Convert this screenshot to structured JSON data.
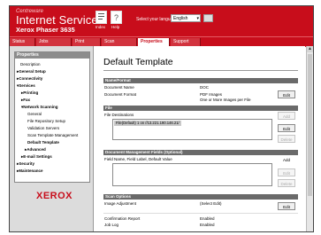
{
  "header": {
    "brand_top": "Centreware",
    "brand_main": "Internet Services",
    "model": "Xerox Phaser 3635",
    "icons": [
      {
        "name": "index-icon",
        "label": "Index"
      },
      {
        "name": "help-icon",
        "label": "Help"
      }
    ],
    "language_label": "Select your language :",
    "language_value": "English"
  },
  "tabs": [
    {
      "label": "Status",
      "active": false
    },
    {
      "label": "Jobs",
      "active": false
    },
    {
      "label": "Print",
      "active": false
    },
    {
      "label": "Scan",
      "active": false
    },
    {
      "label": "Properties",
      "active": true
    },
    {
      "label": "Support",
      "active": false
    }
  ],
  "sidebar": {
    "title": "Properties",
    "items": [
      {
        "label": "Description",
        "bold": false
      },
      {
        "label": "▸General Setup",
        "bold": true
      },
      {
        "label": "▸Connectivity",
        "bold": true
      },
      {
        "label": "▾Services",
        "bold": true
      },
      {
        "label": "▸Printing",
        "bold": true
      },
      {
        "label": "▸Fax",
        "bold": true
      },
      {
        "label": "▾Network Scanning",
        "bold": true
      },
      {
        "label": "General",
        "bold": false
      },
      {
        "label": "File Repository Setup",
        "bold": false
      },
      {
        "label": "Validation Servers",
        "bold": false
      },
      {
        "label": "Scan Template Management",
        "bold": false
      },
      {
        "label": "Default Template",
        "bold": true
      },
      {
        "label": "▸Advanced",
        "bold": true
      },
      {
        "label": "▸E-mail Settings",
        "bold": true
      },
      {
        "label": "▸Security",
        "bold": true
      },
      {
        "label": "▸Maintenance",
        "bold": true
      }
    ],
    "logo": "XEROX"
  },
  "main": {
    "title": "Default Template",
    "name_format": {
      "heading": "Name/Format",
      "doc_name_label": "Document Name",
      "doc_name_value": "DOC",
      "doc_format_label": "Document Format",
      "doc_format_value1": "PDF Images",
      "doc_format_value2": "One or More Images per File",
      "edit_label": "Edit"
    },
    "file": {
      "heading": "File",
      "destinations_label": "File Destinations",
      "selected_entry": "File(Default) 1 on //13.221.190.146.21/",
      "buttons": [
        "Add",
        "Edit",
        "Delete"
      ]
    },
    "dm_fields": {
      "heading": "Document Management Fields (Optional)",
      "field_label": "Field Name, Field Label, Default Value",
      "buttons": [
        "Add",
        "Edit",
        "Delete"
      ]
    },
    "scan_options": {
      "heading": "Scan Options",
      "image_adj_label": "Image Adjustment",
      "image_adj_value": "(Select Edit)",
      "edit_label": "Edit",
      "confirmation_label": "Confirmation Report",
      "confirmation_value": "Enabled",
      "joblog_label": "Job Log",
      "joblog_value": "Enabled"
    }
  }
}
